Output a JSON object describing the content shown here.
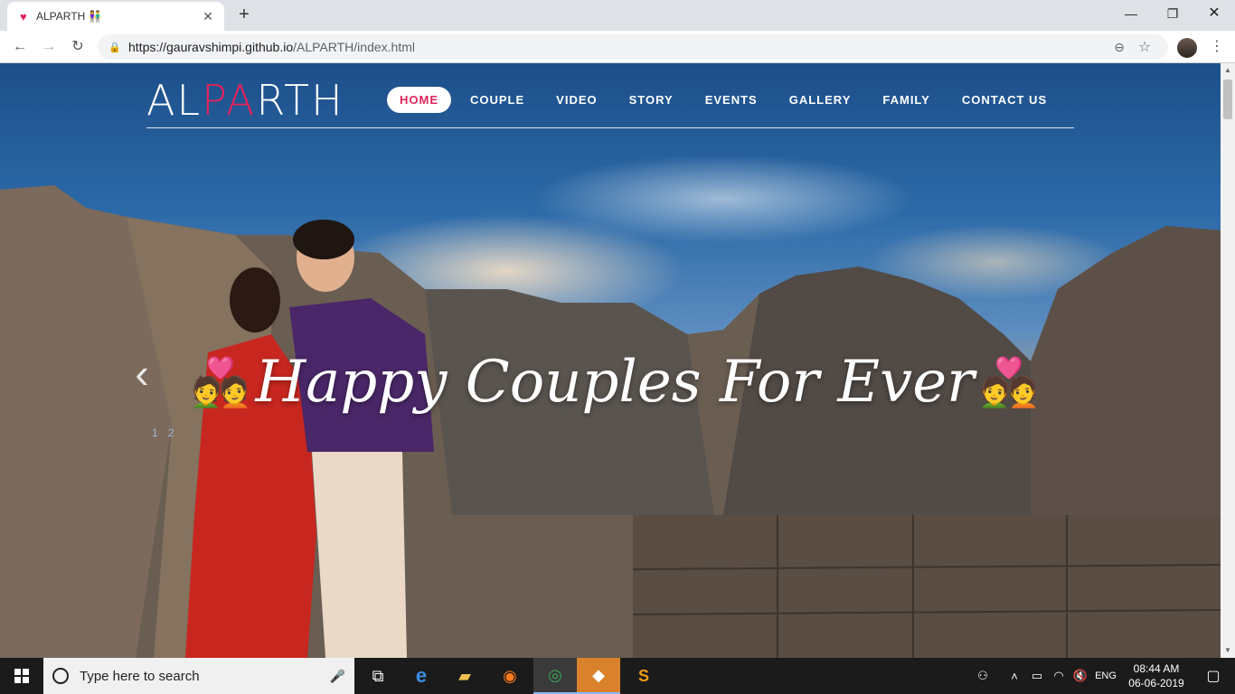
{
  "browser": {
    "tab_title": "ALPARTH 👫",
    "tab_favicon": "♥",
    "tab_close": "✕",
    "new_tab": "+",
    "url_host": "https://gauravshimpi.github.io",
    "url_path": "/ALPARTH/index.html",
    "window_controls": {
      "minimize": "—",
      "maximize": "❐",
      "close": "✕"
    }
  },
  "site": {
    "logo_left": "AL",
    "logo_accent": "PA",
    "logo_right": "RTH",
    "accent_color": "#e0245e",
    "nav": [
      {
        "label": "HOME",
        "active": true
      },
      {
        "label": "COUPLE"
      },
      {
        "label": "VIDEO"
      },
      {
        "label": "STORY"
      },
      {
        "label": "EVENTS"
      },
      {
        "label": "GALLERY"
      },
      {
        "label": "FAMILY"
      },
      {
        "label": "CONTACT US"
      }
    ]
  },
  "hero": {
    "emoji": "💑",
    "title": "Happy Couples For Ever",
    "prev_arrow": "‹",
    "pager": [
      "1",
      "2"
    ]
  },
  "taskbar": {
    "search_placeholder": "Type here to search",
    "language": "ENG",
    "time": "08:44 AM",
    "date": "06-06-2019"
  }
}
